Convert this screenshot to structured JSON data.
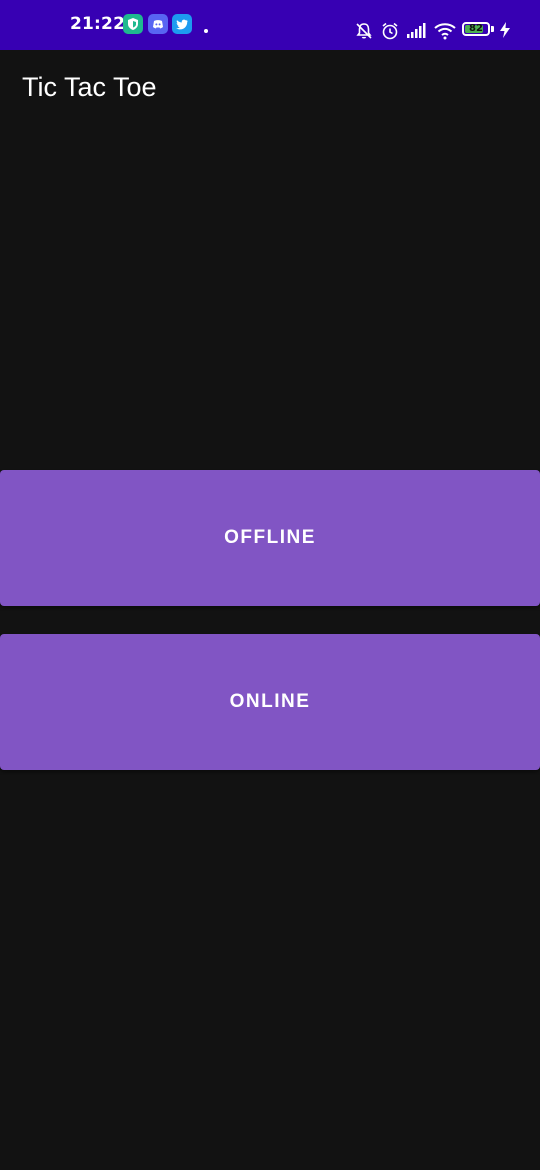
{
  "status_bar": {
    "time": "21:22",
    "battery": "82",
    "background_color": "#3700b3",
    "notification_icons": [
      "vpn-shield-icon",
      "discord-icon",
      "twitter-icon"
    ],
    "system_icons": [
      "notifications-off-icon",
      "alarm-icon",
      "signal-icon",
      "wifi-icon",
      "battery-icon",
      "charging-icon"
    ]
  },
  "app_bar": {
    "title": "Tic Tac Toe"
  },
  "main": {
    "offline_label": "OFFLINE",
    "online_label": "ONLINE",
    "button_color": "#8155c4"
  },
  "theme": {
    "background": "#121212"
  }
}
